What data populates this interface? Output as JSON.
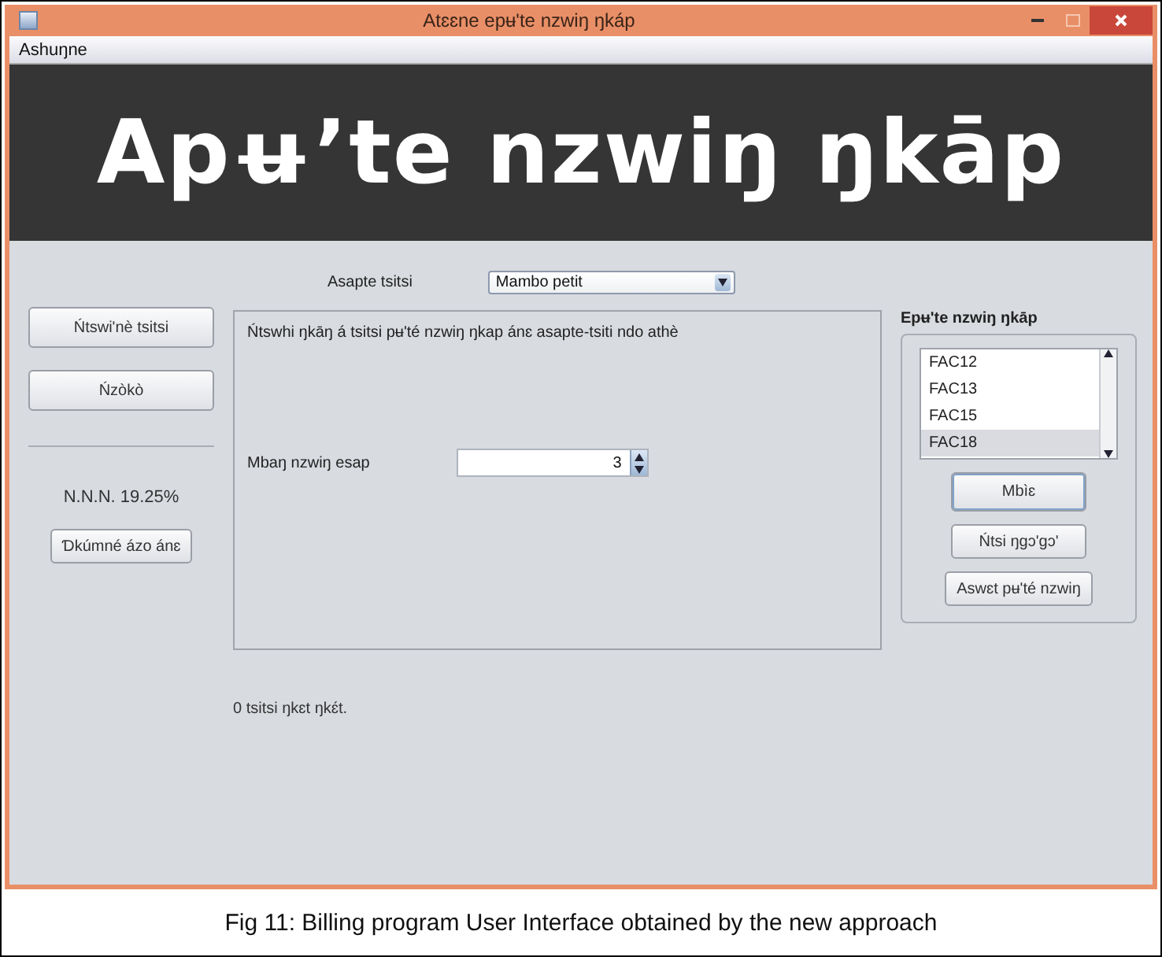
{
  "window": {
    "title": "Atɛɛne epʉ'te nzwiŋ ŋkáp"
  },
  "menu": [
    "Ashuŋne"
  ],
  "banner": {
    "title": "Apʉ’te nzwiŋ ŋkāp"
  },
  "left_buttons": [
    "Ńtswi'nè tsitsi",
    "Ńzòkò"
  ],
  "tax_rate": "N.N.N. 19.25%",
  "left_action": "Ɗkúmné ázo ánɛ",
  "category": {
    "label": "Asapte tsitsi",
    "value": "Mambo petit"
  },
  "panel": {
    "instruction": "Ńtswhi ŋkāŋ á tsitsi pʉ'té nzwiŋ ŋkap ánɛ asapte-tsiti ndo athè",
    "quantity_label": "Mbaŋ nzwiŋ esap",
    "quantity_value": "3"
  },
  "status": "0 tsitsi ŋkɛt ŋkɛ́t.",
  "invoices": {
    "title": "Epʉ'te nzwiŋ ŋkāp",
    "items": [
      {
        "label": "FAC12",
        "selected": false
      },
      {
        "label": "FAC13",
        "selected": false
      },
      {
        "label": "FAC15",
        "selected": false
      },
      {
        "label": "FAC18",
        "selected": true
      }
    ],
    "buttons": [
      "Mbìɛ",
      "Ńtsi ŋgɔ'gɔ'",
      "Aswɛt pʉ'té nzwiŋ"
    ]
  },
  "caption": "Fig 11: Billing program User Interface obtained by the new approach"
}
